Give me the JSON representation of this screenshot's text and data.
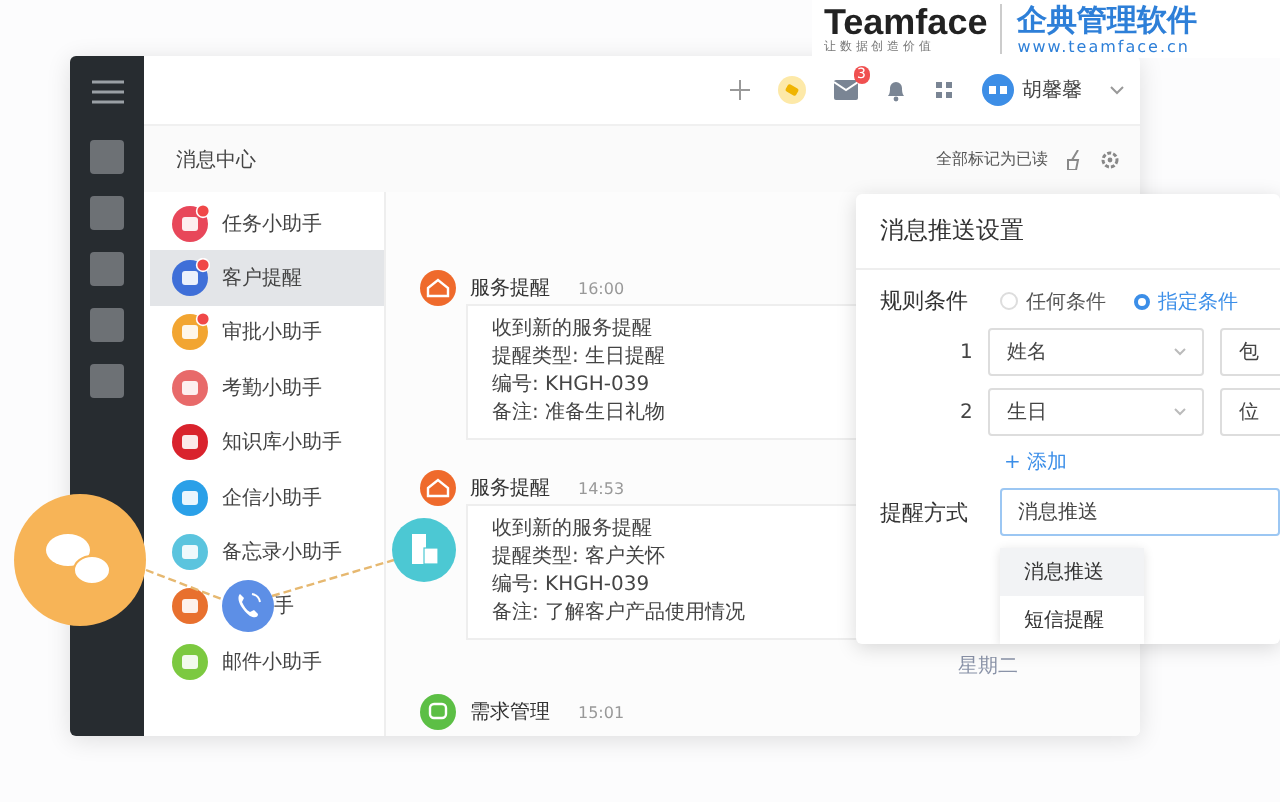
{
  "brand": {
    "name": "Teamface",
    "tagline": "让 数 据 创 造 价 值",
    "product": "企典管理软件",
    "url": "www.teamface.cn"
  },
  "topbar": {
    "mail_badge": "3",
    "user_name": "胡馨馨"
  },
  "header": {
    "title": "消息中心",
    "mark_all": "全部标记为已读"
  },
  "assistants": [
    {
      "name": "任务小助手",
      "color": "#e8475a",
      "unread": true,
      "selected": false
    },
    {
      "name": "客户提醒",
      "color": "#3f6fd8",
      "unread": true,
      "selected": true
    },
    {
      "name": "审批小助手",
      "color": "#f2a531",
      "unread": true,
      "selected": false
    },
    {
      "name": "考勤小助手",
      "color": "#e86a6a",
      "unread": false,
      "selected": false
    },
    {
      "name": "知识库小助手",
      "color": "#d9232d",
      "unread": false,
      "selected": false
    },
    {
      "name": "企信小助手",
      "color": "#2aa0e8",
      "unread": false,
      "selected": false
    },
    {
      "name": "备忘录小助手",
      "color": "#5bc4de",
      "unread": false,
      "selected": false
    },
    {
      "name": "手",
      "color": "#e8702e",
      "unread": false,
      "selected": false,
      "covered": true
    },
    {
      "name": "邮件小助手",
      "color": "#7cc940",
      "unread": false,
      "selected": false
    }
  ],
  "messages": [
    {
      "kind": "service",
      "sender": "服务提醒",
      "time": "16:00",
      "lines": [
        "收到新的服务提醒",
        "提醒类型: 生日提醒",
        "编号: KHGH-039",
        "备注:  准备生日礼物"
      ]
    },
    {
      "kind": "service",
      "sender": "服务提醒",
      "time": "14:53",
      "lines": [
        "收到新的服务提醒",
        "提醒类型: 客户关怀",
        "编号: KHGH-039",
        "备注:  了解客户产品使用情况"
      ]
    },
    {
      "kind": "separator",
      "label": "星期二"
    },
    {
      "kind": "demand",
      "sender": "需求管理",
      "time": "15:01"
    }
  ],
  "panel": {
    "title": "消息推送设置",
    "rule_label": "规则条件",
    "options": [
      {
        "label": "任何条件",
        "selected": false
      },
      {
        "label": "指定条件",
        "selected": true
      }
    ],
    "conditions": [
      {
        "index": "1",
        "field": "姓名",
        "operator": "包"
      },
      {
        "index": "2",
        "field": "生日",
        "operator": "位"
      }
    ],
    "add": "+ 添加",
    "remind_label": "提醒方式",
    "remind_value": "消息推送",
    "dropdown": [
      {
        "label": "消息推送",
        "selected": true
      },
      {
        "label": "短信提醒",
        "selected": false
      }
    ]
  }
}
